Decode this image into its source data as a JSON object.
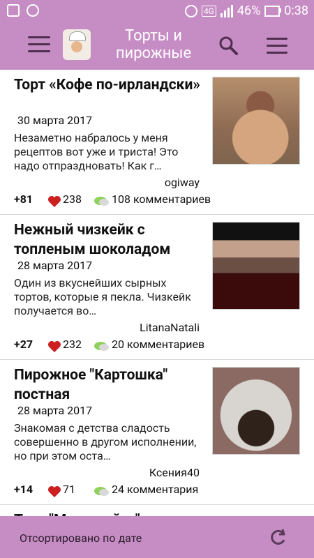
{
  "status_bar": {
    "network": "4G",
    "battery": "46%",
    "time": "0:38"
  },
  "app": {
    "title": "Торты и пирожные"
  },
  "colors": {
    "primary": "#c68dc4",
    "heart": "#cc1f1f"
  },
  "list": {
    "items": [
      {
        "title": "Торт «Кофе по-ирландски»",
        "date": "30 марта 2017",
        "snippet": "Незаметно набралось у меня рецептов вот уже и триста! Это надо отпраздновать! Как г…",
        "author": "ogiway",
        "score": "+81",
        "likes": "238",
        "comments": "108 комментариев",
        "image_icon": "cake-photo"
      },
      {
        "title": "Нежный чизкейк с топленым шоколадом",
        "date": "28 марта 2017",
        "snippet": "Один из вкуснейших сырных тортов, которые я пекла. Чизкейк получается во…",
        "author": "LitanaNatali",
        "score": "+27",
        "likes": "232",
        "comments": "20 комментариев",
        "image_icon": "cheesecake-photo"
      },
      {
        "title": "Пирожное \"Картошка\" постная",
        "date": "28 марта 2017",
        "snippet": "Знакомая с детства сладость совершенно в другом исполнении, но при этом оста…",
        "author": "Ксения40",
        "score": "+14",
        "likes": "71",
        "comments": "24 комментария",
        "image_icon": "pastry-photo"
      }
    ],
    "partial_next_title": "Торт \"Медовый ...\""
  },
  "bottom_bar": {
    "label": "Отсортировано по дате"
  }
}
